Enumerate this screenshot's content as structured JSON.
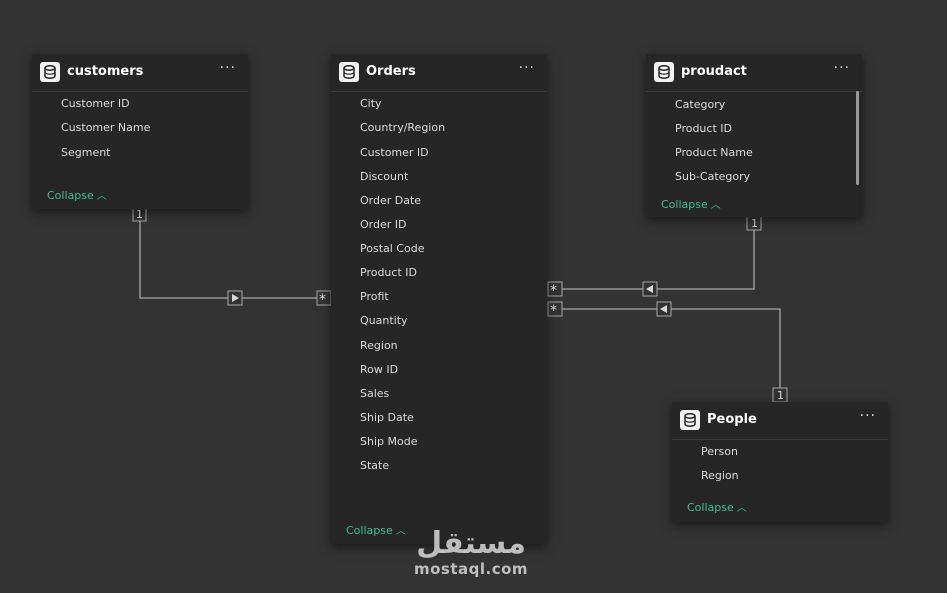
{
  "tables": {
    "customers": {
      "title": "customers",
      "fields": [
        "Customer ID",
        "Customer Name",
        "Segment"
      ],
      "collapse_label": "Collapse"
    },
    "orders": {
      "title": "Orders",
      "fields": [
        "City",
        "Country/Region",
        "Customer ID",
        "Discount",
        "Order Date",
        "Order ID",
        "Postal Code",
        "Product ID",
        "Profit",
        "Quantity",
        "Region",
        "Row ID",
        "Sales",
        "Ship Date",
        "Ship Mode",
        "State"
      ],
      "collapse_label": "Collapse"
    },
    "proudact": {
      "title": "proudact",
      "fields": [
        "Category",
        "Product ID",
        "Product Name",
        "Sub-Category"
      ],
      "collapse_label": "Collapse"
    },
    "people": {
      "title": "People",
      "fields": [
        "Person",
        "Region"
      ],
      "collapse_label": "Collapse"
    }
  },
  "more_label": "···",
  "relationships": [
    {
      "from": "customers",
      "to": "Orders",
      "one_label": "1",
      "many_label": "*"
    },
    {
      "from": "proudact",
      "to": "Orders",
      "one_label": "1",
      "many_label": "*"
    },
    {
      "from": "People",
      "to": "Orders",
      "one_label": "1",
      "many_label": "*"
    }
  ],
  "watermark": {
    "arabic": "مستقل",
    "latin": "mostaql.com"
  },
  "colors": {
    "canvas": "#333333",
    "card": "#262626",
    "accent": "#3dbf95",
    "line": "#a8a8a8"
  }
}
